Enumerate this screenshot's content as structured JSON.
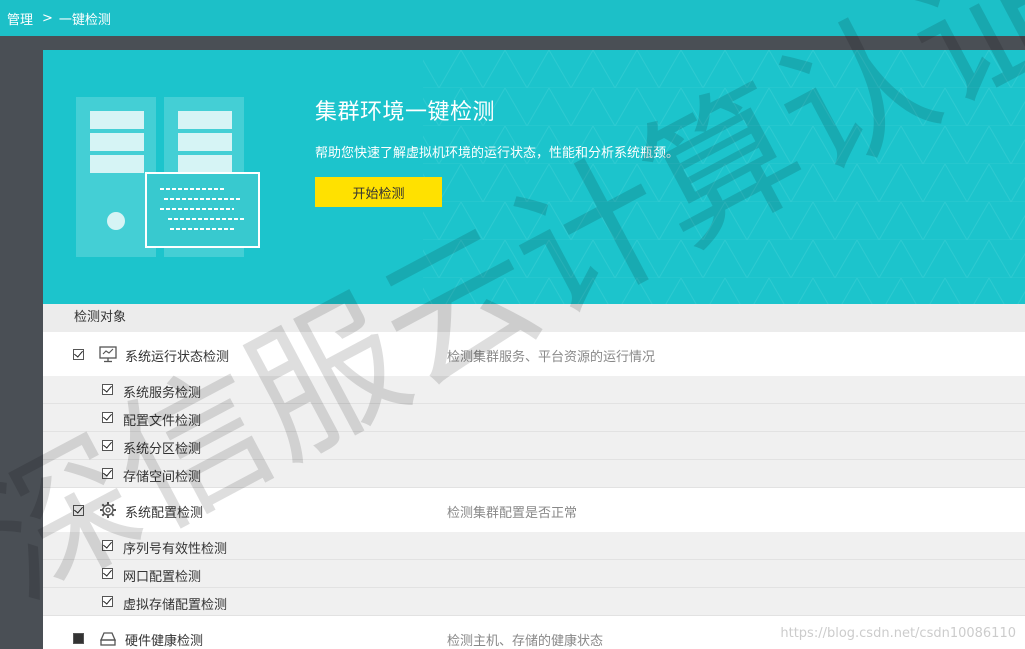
{
  "breadcrumb": {
    "root": "管理",
    "separator": ">",
    "current": "一键检测"
  },
  "hero": {
    "title": "集群环境一键检测",
    "subtitle": "帮助您快速了解虚拟机环境的运行状态，性能和分析系统瓶颈。",
    "start_button": "开始检测"
  },
  "section_header": "检测对象",
  "groups": [
    {
      "label": "系统运行状态检测",
      "description": "检测集群服务、平台资源的运行情况",
      "icon": "monitor-icon",
      "checked": true,
      "items": [
        {
          "label": "系统服务检测",
          "checked": true
        },
        {
          "label": "配置文件检测",
          "checked": true
        },
        {
          "label": "系统分区检测",
          "checked": true
        },
        {
          "label": "存储空间检测",
          "checked": true
        }
      ]
    },
    {
      "label": "系统配置检测",
      "description": "检测集群配置是否正常",
      "icon": "gear-icon",
      "checked": true,
      "items": [
        {
          "label": "序列号有效性检测",
          "checked": true
        },
        {
          "label": "网口配置检测",
          "checked": true
        },
        {
          "label": "虚拟存储配置检测",
          "checked": true
        }
      ]
    },
    {
      "label": "硬件健康检测",
      "description": "检测主机、存储的健康状态",
      "icon": "hardware-icon",
      "checked": true
    }
  ],
  "watermark": {
    "text": "深信服云计算认证",
    "credit": "https://blog.csdn.net/csdn10086110"
  },
  "colors": {
    "topbar": "#1cc0c8",
    "hero": "#1cc4cc",
    "button": "#ffe100",
    "rail": "#4a4f55"
  }
}
